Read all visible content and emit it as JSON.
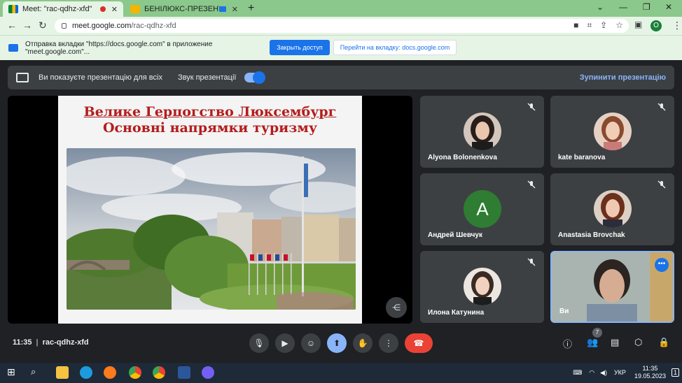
{
  "browser": {
    "tabs": [
      {
        "title": "Meet: \"rac-qdhz-xfd\"",
        "active": true
      },
      {
        "title": "БЕНІЛЮКС-ПРЕЗЕНТА.ppt",
        "active": false
      }
    ],
    "url_host": "meet.google.com",
    "url_path": "/rac-qdhz-xfd",
    "profile_initial": "O"
  },
  "infobar": {
    "message": "Отправка вкладки \"https://docs.google.com\" в приложение \"meet.google.com\"...",
    "primary_button": "Закрыть доступ",
    "secondary_button": "Перейти на вкладку: docs.google.com"
  },
  "presenting_bar": {
    "message": "Ви показуєте презентацію для всіх",
    "sound_label": "Звук презентації",
    "sound_enabled": true,
    "stop_button": "Зупинити презентацію"
  },
  "slide": {
    "title_line1": "Велике Герцогство Люксембург",
    "title_line2": "Основні напрямки туризму"
  },
  "participants": [
    {
      "name": "Alyona Bolonenkova",
      "muted": true
    },
    {
      "name": "kate baranova",
      "muted": true
    },
    {
      "name": "Андрей Шевчук",
      "muted": true,
      "initial": "A"
    },
    {
      "name": "Anastasia Brovchak",
      "muted": true
    },
    {
      "name": "Илона Катунина",
      "muted": true
    },
    {
      "name": "Ви",
      "self": true
    }
  ],
  "meeting_bar": {
    "time": "11:35",
    "meeting_code": "rac-qdhz-xfd",
    "participant_count": "7"
  },
  "taskbar": {
    "language": "УКР",
    "time": "11:35",
    "date": "19.05.2023",
    "notification_count": "1"
  },
  "colors": {
    "accent": "#1a73e8",
    "end_call": "#ea4335",
    "tab_strip": "#8bc88b",
    "slide_title": "#b31c1c"
  }
}
